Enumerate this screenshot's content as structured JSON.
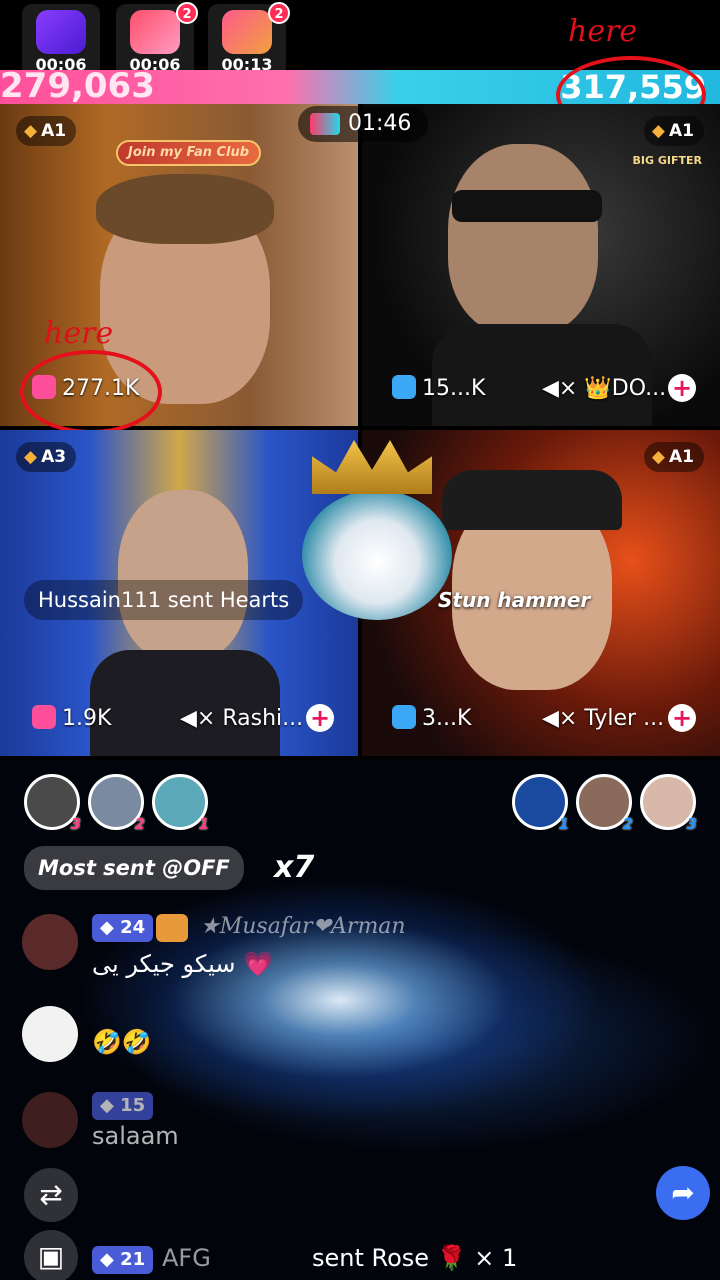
{
  "timers": [
    {
      "time": "00:06",
      "icon": "lightning-icon",
      "badge": ""
    },
    {
      "time": "00:06",
      "icon": "gift-box-icon",
      "badge": "2"
    },
    {
      "time": "00:13",
      "icon": "treasure-chest-icon",
      "badge": "2"
    }
  ],
  "battle": {
    "left_score": "279,063",
    "right_score": "317,559",
    "countdown": "01:46"
  },
  "annotations": {
    "top": "here",
    "left": "here"
  },
  "tiles": [
    {
      "rank": "A1",
      "stat": "277.1K",
      "fan_club": "Join my Fan Club",
      "name": "",
      "muted": false
    },
    {
      "rank": "A1",
      "stat": "15...K",
      "name": "👑DO...",
      "muted": true,
      "tag": "BIG GIFTER"
    },
    {
      "rank": "A3",
      "stat": "1.9K",
      "name": "Rashi...",
      "muted": true
    },
    {
      "rank": "A1",
      "stat": "3...K",
      "name": "Tyler ...",
      "muted": true
    }
  ],
  "gift_events": {
    "left": "Hussain111 sent Hearts",
    "right": "Stun hammer"
  },
  "top_gifters": {
    "left": [
      "3",
      "2",
      "1"
    ],
    "right": [
      "1",
      "2",
      "3"
    ]
  },
  "most_sent": {
    "label": "Most sent @OFF",
    "count": "x7"
  },
  "chat": [
    {
      "level": "24",
      "user": "★Musafar❤Arman",
      "message": "سیکو جیکر یی 💗"
    },
    {
      "level": "",
      "user": "",
      "message": "🤣🤣"
    },
    {
      "level": "15",
      "user": "",
      "message": "salaam"
    },
    {
      "level": "21",
      "user": "AFG",
      "message": "sent Rose 🌹 × 1"
    }
  ]
}
